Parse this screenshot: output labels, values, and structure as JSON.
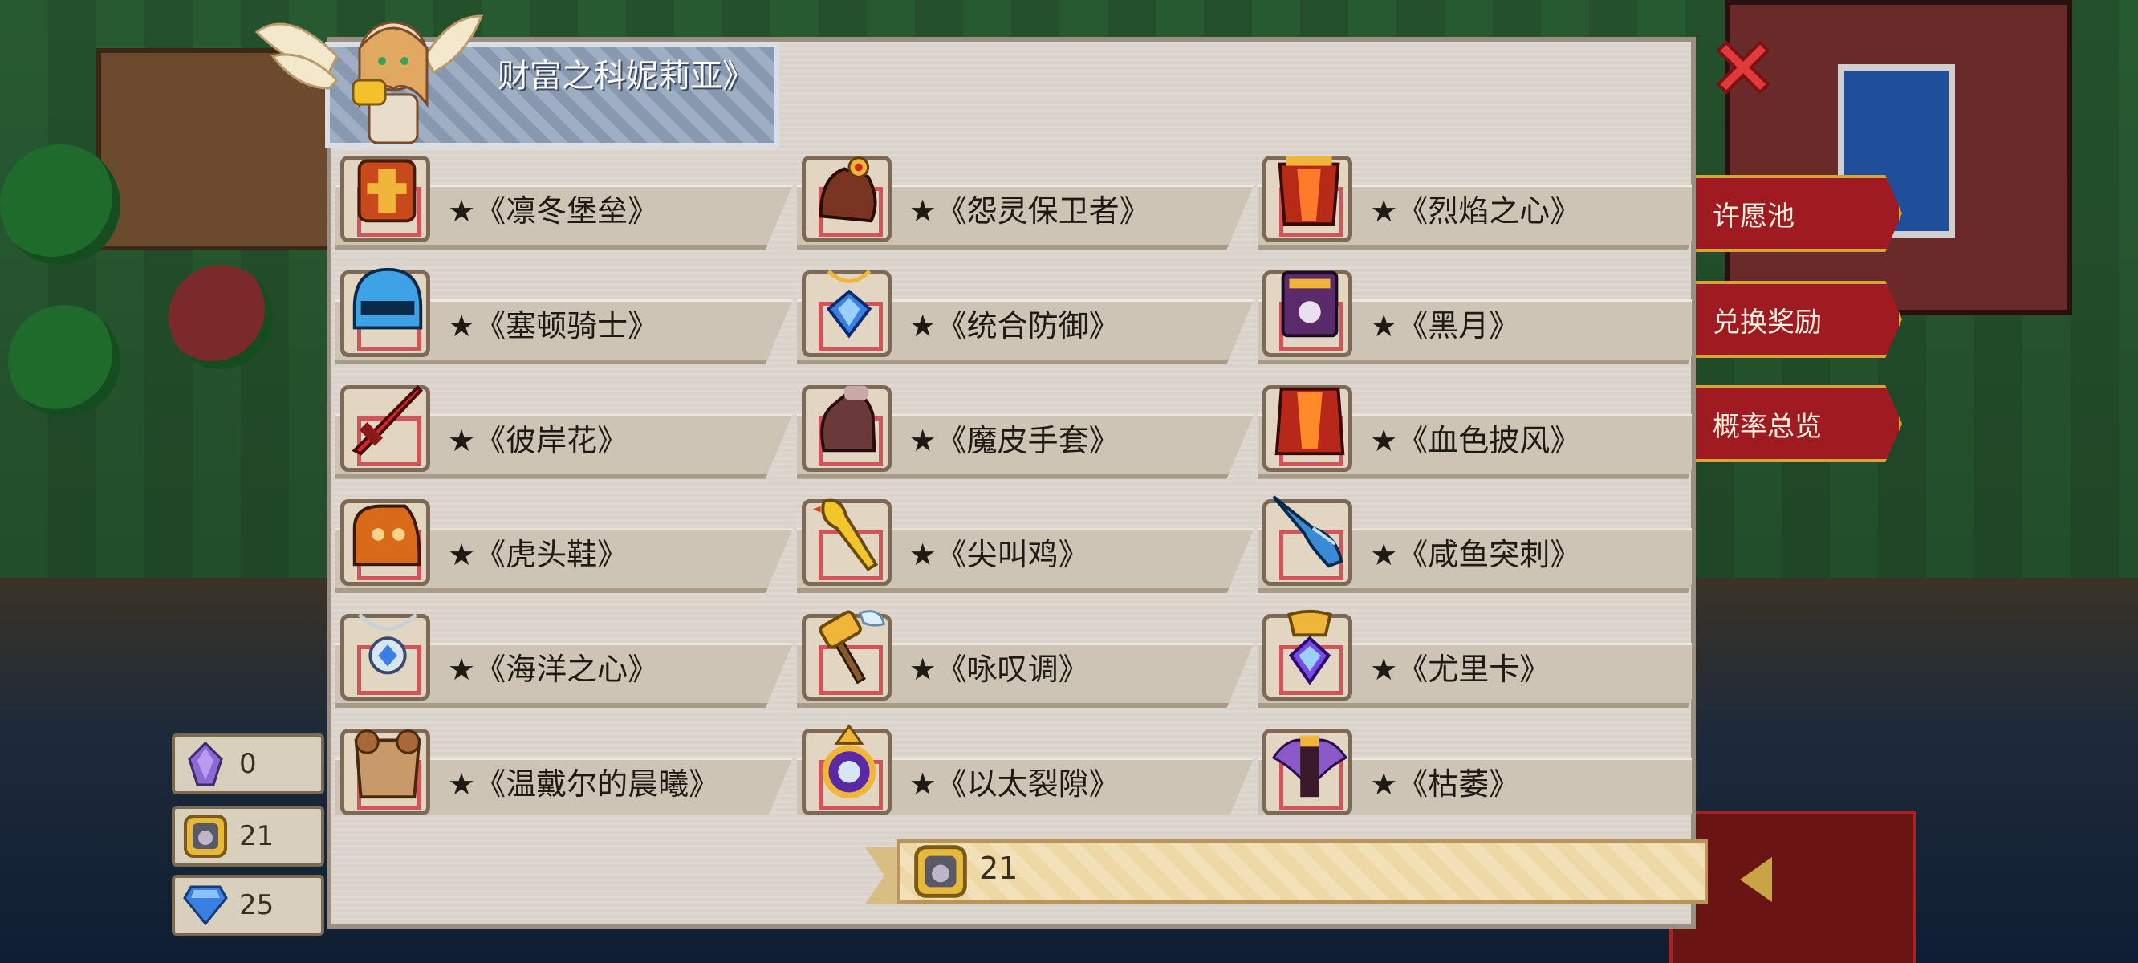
{
  "dialog": {
    "title": "财富之科妮莉亚》",
    "items": [
      {
        "label": "★《凛冬堡垒》",
        "icon": "armor-winter-fortress-icon"
      },
      {
        "label": "★《怨灵保卫者》",
        "icon": "gauntlet-wraith-guardian-icon"
      },
      {
        "label": "★《烈焰之心》",
        "icon": "armor-flame-heart-icon"
      },
      {
        "label": "★《塞顿骑士》",
        "icon": "helmet-knight-icon"
      },
      {
        "label": "★《统合防御》",
        "icon": "gem-amulet-icon"
      },
      {
        "label": "★《黑月》",
        "icon": "dark-tome-icon"
      },
      {
        "label": "★《彼岸花》",
        "icon": "red-blade-icon"
      },
      {
        "label": "★《魔皮手套》",
        "icon": "demon-glove-icon"
      },
      {
        "label": "★《血色披风》",
        "icon": "crimson-cape-icon"
      },
      {
        "label": "★《虎头鞋》",
        "icon": "tiger-shoe-icon"
      },
      {
        "label": "★《尖叫鸡》",
        "icon": "screaming-chicken-icon"
      },
      {
        "label": "★《咸鱼突刺》",
        "icon": "salted-fish-icon"
      },
      {
        "label": "★《海洋之心》",
        "icon": "ocean-heart-necklace-icon"
      },
      {
        "label": "★《咏叹调》",
        "icon": "winged-hammer-icon"
      },
      {
        "label": "★《尤里卡》",
        "icon": "crystal-pendant-icon"
      },
      {
        "label": "★《温戴尔的晨曦》",
        "icon": "dawn-armor-icon"
      },
      {
        "label": "★《以太裂隙》",
        "icon": "ether-ring-icon"
      },
      {
        "label": "★《枯萎》",
        "icon": "withered-wings-icon"
      }
    ],
    "bottom_value": "21"
  },
  "side_menu": [
    "许愿池",
    "兑换奖励",
    "概率总览"
  ],
  "resources": [
    {
      "icon": "purple-crystal-icon",
      "value": "0"
    },
    {
      "icon": "token-coin-icon",
      "value": "21"
    },
    {
      "icon": "blue-diamond-icon",
      "value": "25"
    }
  ]
}
